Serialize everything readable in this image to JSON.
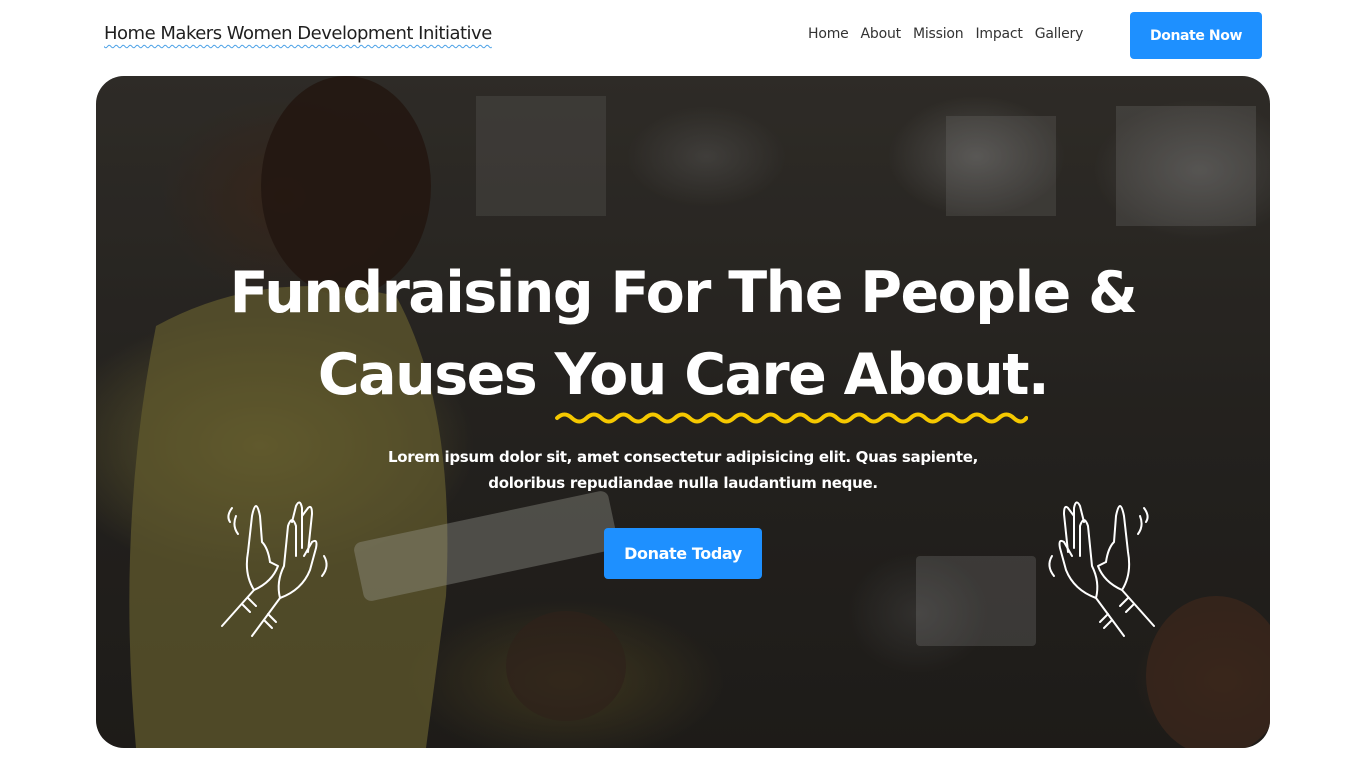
{
  "header": {
    "logo": "Home Makers Women Development Initiative",
    "nav": [
      {
        "label": "Home"
      },
      {
        "label": "About"
      },
      {
        "label": "Mission"
      },
      {
        "label": "Impact"
      },
      {
        "label": "Gallery"
      }
    ],
    "cta_label": "Donate Now"
  },
  "hero": {
    "headline_line1": "Fundraising For The People &",
    "headline_line2_start": "Causes ",
    "headline_highlight": "You Care About",
    "headline_end": ".",
    "subtext": "Lorem ipsum dolor sit, amet consectetur adipisicing elit. Quas sapiente, doloribus repudiandae nulla laudantium neque.",
    "cta_label": "Donate Today",
    "decorations": [
      "clapping-hands-icon",
      "clapping-hands-icon"
    ]
  },
  "colors": {
    "accent": "#1e90ff",
    "highlight_underline": "#f5c800",
    "logo_underline": "#4aa0e6",
    "text_dark": "#1f1f1f",
    "text_light": "#ffffff"
  }
}
